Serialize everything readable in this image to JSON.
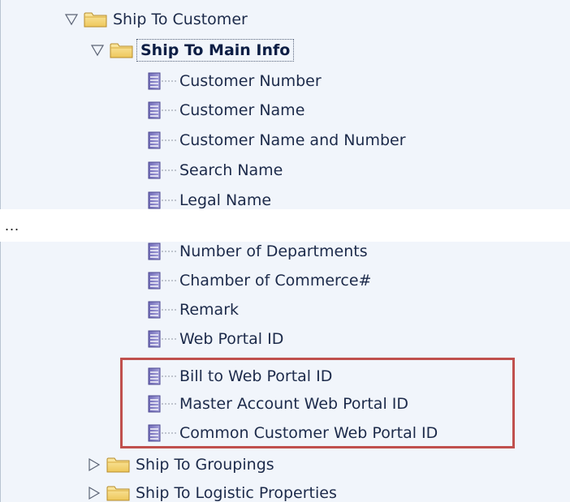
{
  "tree_top": {
    "root": {
      "label": "Ship To Customer",
      "expanded_icon": "triangle-down-icon",
      "folder_icon": "folder-icon"
    },
    "child": {
      "label": "Ship To Main Info",
      "expanded_icon": "triangle-down-icon",
      "folder_icon": "folder-icon",
      "selected": true
    },
    "items": [
      {
        "label": "Customer Number",
        "icon": "column-item-icon"
      },
      {
        "label": "Customer Name",
        "icon": "column-item-icon"
      },
      {
        "label": "Customer Name and Number",
        "icon": "column-item-icon"
      },
      {
        "label": "Search Name",
        "icon": "column-item-icon"
      },
      {
        "label": "Legal Name",
        "icon": "column-item-icon"
      }
    ]
  },
  "separator": "...",
  "tree_bottom": {
    "items": [
      {
        "label": "Number of Departments",
        "icon": "column-item-icon"
      },
      {
        "label": "Chamber of Commerce#",
        "icon": "column-item-icon"
      },
      {
        "label": "Remark",
        "icon": "column-item-icon"
      },
      {
        "label": "Web Portal ID",
        "icon": "column-item-icon"
      },
      {
        "label": "Bill to Web Portal ID",
        "icon": "column-item-icon",
        "highlighted": true
      },
      {
        "label": "Master Account Web Portal ID",
        "icon": "column-item-icon",
        "highlighted": true
      },
      {
        "label": "Common Customer Web Portal ID",
        "icon": "column-item-icon",
        "highlighted": true
      }
    ],
    "folders": [
      {
        "label": "Ship To Groupings",
        "collapsed_icon": "triangle-right-icon",
        "folder_icon": "folder-icon"
      },
      {
        "label": "Ship To Logistic Properties",
        "collapsed_icon": "triangle-right-icon",
        "folder_icon": "folder-icon"
      }
    ]
  },
  "colors": {
    "panel_bg": "#f1f5fb",
    "highlight_border": "#c0504d",
    "folder_fill": "#f4d77a",
    "item_icon_fill": "#8a86c8"
  }
}
